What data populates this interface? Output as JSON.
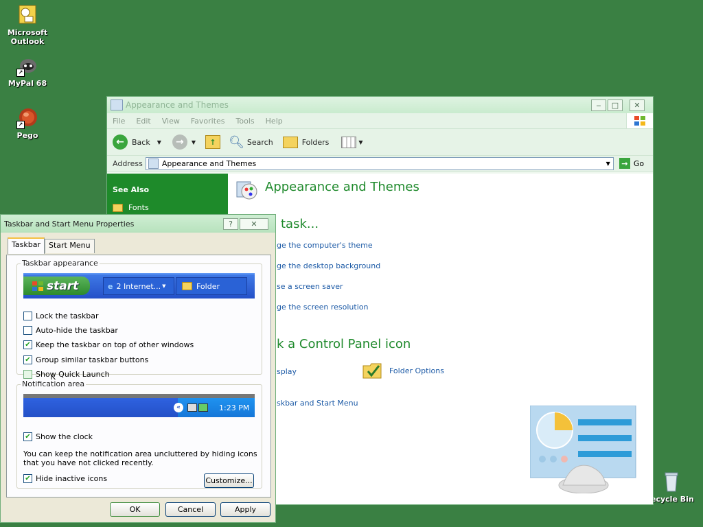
{
  "desktop": {
    "icons": [
      {
        "label": "Microsoft Outlook",
        "icon": "outlook-icon"
      },
      {
        "label": "MyPal 68",
        "icon": "mypal-icon"
      },
      {
        "label": "Pego",
        "icon": "pego-icon"
      },
      {
        "label": "ecycle Bin",
        "icon": "recycle-bin-icon"
      }
    ]
  },
  "explorer": {
    "title": "Appearance and Themes",
    "menu": [
      "File",
      "Edit",
      "View",
      "Favorites",
      "Tools",
      "Help"
    ],
    "toolbar": {
      "back": "Back",
      "search": "Search",
      "folders": "Folders"
    },
    "address": {
      "label": "Address",
      "value": "Appearance and Themes",
      "go": "Go"
    },
    "see_also": {
      "title": "See Also",
      "items": [
        "Fonts"
      ]
    },
    "page_title": "Appearance and Themes",
    "pick_task": "task...",
    "tasks": [
      "ge the computer's theme",
      "ge the desktop background",
      "se a screen saver",
      "ge the screen resolution"
    ],
    "pick_icon": "k a Control Panel icon",
    "icons": [
      "splay",
      "Folder Options",
      "skbar and Start Menu"
    ]
  },
  "dialog": {
    "title": "Taskbar and Start Menu Properties",
    "tabs": [
      "Taskbar",
      "Start Menu"
    ],
    "appearance_label": "Taskbar appearance",
    "preview": {
      "start": "start",
      "internet": "2 Internet...",
      "folder": "Folder"
    },
    "checkboxes": [
      {
        "label": "Lock the taskbar",
        "checked": false
      },
      {
        "label": "Auto-hide the taskbar",
        "checked": false
      },
      {
        "label": "Keep the taskbar on top of other windows",
        "checked": true
      },
      {
        "label": "Group similar taskbar buttons",
        "checked": true
      },
      {
        "label": "Show Quick Launch",
        "checked": false
      }
    ],
    "notification_label": "Notification area",
    "tray_time": "1:23 PM",
    "show_clock": "Show the clock",
    "description": "You can keep the notification area uncluttered by hiding icons that you have not clicked recently.",
    "hide_inactive": "Hide inactive icons",
    "customize": "Customize...",
    "ok": "OK",
    "cancel": "Cancel",
    "apply": "Apply"
  },
  "colors": {
    "desktop": "#3a8043",
    "accent": "#1f8a2c",
    "link": "#1c5aa6"
  }
}
